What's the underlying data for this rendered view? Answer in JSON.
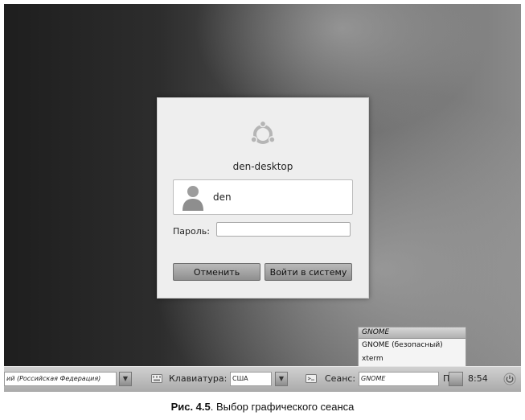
{
  "login": {
    "hostname": "den-desktop",
    "user_name": "den",
    "password_label": "Пароль:",
    "password_value": "",
    "cancel_label": "Отменить",
    "login_label": "Войти в систему",
    "logo_icon": "ubuntu-logo-icon",
    "avatar_icon": "user-avatar-icon"
  },
  "session_menu": {
    "header": "GNOME",
    "items": [
      "GNOME (безопасный)",
      "xterm"
    ]
  },
  "panel": {
    "language_value": "ий (Российская Федерация)",
    "keyboard_label": "Клавиатура:",
    "keyboard_value": "США",
    "session_label": "Сеанс:",
    "session_value": "GNOME",
    "day": "Птн",
    "time": "8:54",
    "arrow_glyph": "▼",
    "power_icon": "power-icon"
  },
  "caption": {
    "label": "Рис. 4.5",
    "text": ". Выбор графического сеанса"
  },
  "colors": {
    "panel": "#bcbcbc",
    "dialog": "#eeeeee"
  }
}
